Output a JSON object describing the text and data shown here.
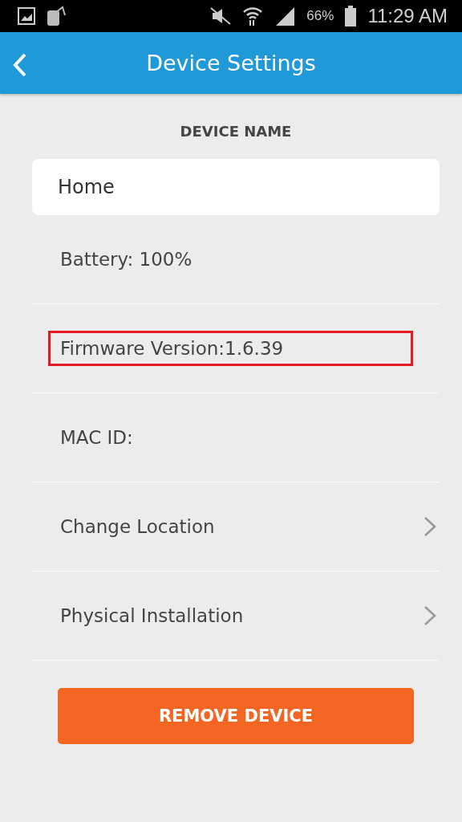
{
  "status_bar": {
    "battery_text": "66%",
    "time": "11:29 AM"
  },
  "header": {
    "title": "Device Settings"
  },
  "device_name": {
    "label": "DEVICE NAME",
    "value": "Home"
  },
  "rows": [
    {
      "kind": "info",
      "text": "Battery: 100%",
      "highlighted": false
    },
    {
      "kind": "info",
      "text": "Firmware Version:1.6.39",
      "highlighted": true
    },
    {
      "kind": "info",
      "text": "MAC ID:",
      "highlighted": false
    },
    {
      "kind": "link",
      "text": "Change Location",
      "highlighted": false
    },
    {
      "kind": "link",
      "text": "Physical Installation",
      "highlighted": false
    }
  ],
  "remove_button": {
    "label": "REMOVE DEVICE"
  }
}
